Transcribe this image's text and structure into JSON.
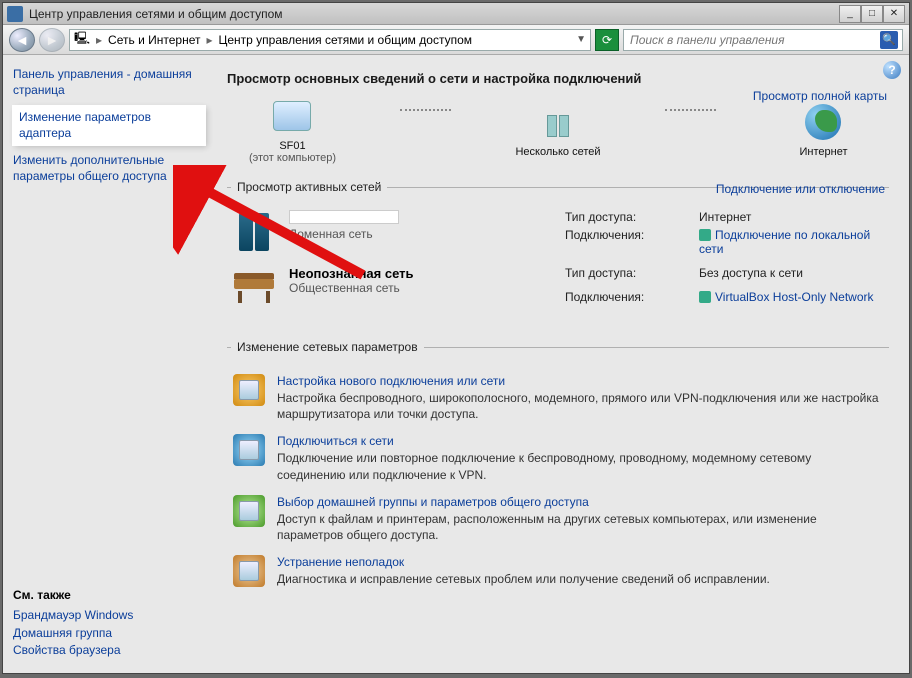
{
  "window": {
    "title": "Центр управления сетями и общим доступом"
  },
  "nav": {
    "crumb1": "Сеть и Интернет",
    "crumb2": "Центр управления сетями и общим доступом",
    "search_placeholder": "Поиск в панели управления"
  },
  "sidebar": {
    "home": "Панель управления - домашняя страница",
    "adapter": "Изменение параметров адаптера",
    "advanced": "Изменить дополнительные параметры общего доступа",
    "see_also_title": "См. также",
    "firewall": "Брандмауэр Windows",
    "homegroup": "Домашняя группа",
    "browser_props": "Свойства браузера"
  },
  "main": {
    "heading": "Просмотр основных сведений о сети и настройка подключений",
    "full_map": "Просмотр полной карты",
    "map": {
      "pc": "SF01",
      "pc_sub": "(этот компьютер)",
      "middle": "Несколько сетей",
      "internet": "Интернет"
    },
    "active_title": "Просмотр активных сетей",
    "active_link": "Подключение или отключение",
    "net1": {
      "type": "Доменная сеть",
      "k_access": "Тип доступа:",
      "v_access": "Интернет",
      "k_conn": "Подключения:",
      "v_conn": "Подключение по локальной сети"
    },
    "net2": {
      "name": "Неопознанная сеть",
      "type": "Общественная сеть",
      "k_access": "Тип доступа:",
      "v_access": "Без доступа к сети",
      "k_conn": "Подключения:",
      "v_conn": "VirtualBox Host-Only Network"
    },
    "change_title": "Изменение сетевых параметров",
    "tasks": {
      "setup": {
        "title": "Настройка нового подключения или сети",
        "desc": "Настройка беспроводного, широкополосного, модемного, прямого или VPN-подключения или же настройка маршрутизатора или точки доступа."
      },
      "connect": {
        "title": "Подключиться к сети",
        "desc": "Подключение или повторное подключение к беспроводному, проводному, модемному сетевому соединению или подключение к VPN."
      },
      "homegrp": {
        "title": "Выбор домашней группы и параметров общего доступа",
        "desc": "Доступ к файлам и принтерам, расположенным на других сетевых компьютерах, или изменение параметров общего доступа."
      },
      "trouble": {
        "title": "Устранение неполадок",
        "desc": "Диагностика и исправление сетевых проблем или получение сведений об исправлении."
      }
    }
  }
}
